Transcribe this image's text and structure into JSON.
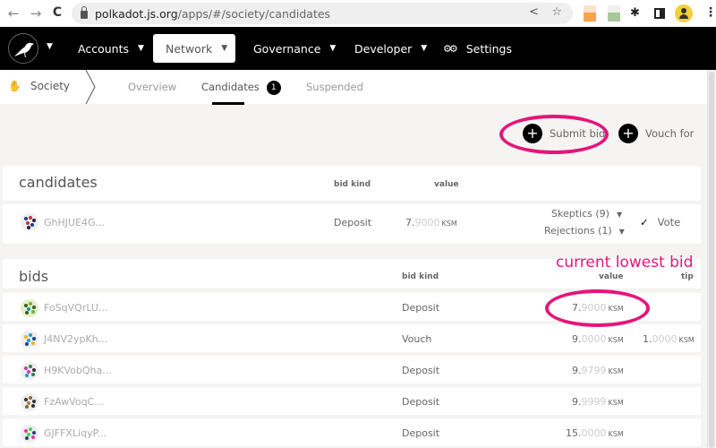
{
  "browser": {
    "url_host": "polkadot.js.org",
    "url_path": "/apps/#/society/candidates",
    "back_icon": "←",
    "forward_icon": "→",
    "reload_icon": "C",
    "share_icon": "<",
    "star_icon": "☆",
    "extensions_icon": "✱",
    "menu_icon": "⋮"
  },
  "topnav": {
    "items": [
      {
        "label": "Accounts",
        "caret": "▼"
      },
      {
        "label": "Network",
        "caret": "▼"
      },
      {
        "label": "Governance",
        "caret": "▼"
      },
      {
        "label": "Developer",
        "caret": "▼"
      },
      {
        "label": "Settings",
        "icon": "⚙⚙"
      }
    ],
    "logo_caret": "▼"
  },
  "subnav": {
    "section": "Society",
    "section_icon": "✋",
    "tabs": [
      {
        "label": "Overview"
      },
      {
        "label": "Candidates",
        "badge": "1"
      },
      {
        "label": "Suspended"
      }
    ]
  },
  "actions": {
    "submit_bid": "Submit bid",
    "vouch_for": "Vouch for",
    "plus": "+"
  },
  "candidates": {
    "title": "candidates",
    "headers": {
      "bid_kind": "bid kind",
      "value": "value"
    },
    "rows": [
      {
        "address": "GhHJUE4G...",
        "kind": "Deposit",
        "value_int": "7.",
        "value_dec": "9000",
        "unit": "KSM",
        "skeptics": "Skeptics (9)",
        "rejections": "Rejections (1)",
        "caret": "▼",
        "vote_check": "✓",
        "vote": "Vote"
      }
    ]
  },
  "bids": {
    "title": "bids",
    "headers": {
      "bid_kind": "bid kind",
      "value": "value",
      "tip": "tip"
    },
    "rows": [
      {
        "address": "FoSqVQrLU...",
        "kind": "Deposit",
        "value_int": "7.",
        "value_dec": "9000",
        "unit": "KSM",
        "tip_int": "",
        "tip_dec": "",
        "tip_unit": ""
      },
      {
        "address": "J4NV2ypKh...",
        "kind": "Vouch",
        "value_int": "9.",
        "value_dec": "0000",
        "unit": "KSM",
        "tip_int": "1.",
        "tip_dec": "0000",
        "tip_unit": "KSM"
      },
      {
        "address": "H9KVobQha...",
        "kind": "Deposit",
        "value_int": "9.",
        "value_dec": "9799",
        "unit": "KSM",
        "tip_int": "",
        "tip_dec": "",
        "tip_unit": ""
      },
      {
        "address": "FzAwVoqC...",
        "kind": "Deposit",
        "value_int": "9.",
        "value_dec": "9999",
        "unit": "KSM",
        "tip_int": "",
        "tip_dec": "",
        "tip_unit": ""
      },
      {
        "address": "GJFFXLiqyP...",
        "kind": "Deposit",
        "value_int": "15.",
        "value_dec": "0000",
        "unit": "KSM",
        "tip_int": "",
        "tip_dec": "",
        "tip_unit": ""
      }
    ]
  },
  "annotation": {
    "text": "current lowest bid",
    "color": "#e5157a"
  }
}
